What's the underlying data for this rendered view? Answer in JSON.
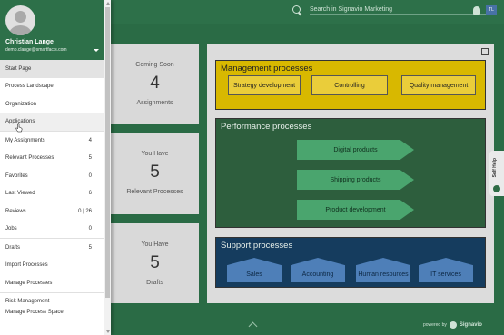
{
  "search": {
    "placeholder": "Search in Signavio Marketing"
  },
  "topbar": {
    "avatar_initials": "TL"
  },
  "user": {
    "name": "Christian Lange",
    "email": "demo.clange@smartfacts.com"
  },
  "sidebar": {
    "items": [
      {
        "label": "Start Page",
        "count": "",
        "state": "active"
      },
      {
        "label": "Process Landscape",
        "count": ""
      },
      {
        "label": "Organization",
        "count": ""
      },
      {
        "label": "Applications",
        "count": "",
        "state": "hover"
      },
      {
        "label": "My Assignments",
        "count": "4"
      },
      {
        "label": "Relevant Processes",
        "count": "5"
      },
      {
        "label": "Favorites",
        "count": "0"
      },
      {
        "label": "Last Viewed",
        "count": "6"
      },
      {
        "label": "Reviews",
        "count": "0 | 26"
      },
      {
        "label": "Jobs",
        "count": "0"
      },
      {
        "label": "Drafts",
        "count": "5"
      },
      {
        "label": "Import Processes",
        "count": ""
      },
      {
        "label": "Manage Processes",
        "count": ""
      },
      {
        "label": "Risk Management",
        "count": ""
      },
      {
        "label": "Manage Process Space",
        "count": ""
      }
    ]
  },
  "cards": [
    {
      "line1": "Coming Soon",
      "number": "4",
      "line2": "Assignments"
    },
    {
      "line1": "You Have",
      "number": "5",
      "line2": "Relevant Processes"
    },
    {
      "line1": "You Have",
      "number": "5",
      "line2": "Drafts"
    }
  ],
  "process_map": {
    "management": {
      "title": "Management processes",
      "items": [
        "Strategy development",
        "Controlling",
        "Quality management"
      ]
    },
    "performance": {
      "title": "Performance processes",
      "items": [
        "Digital products",
        "Shipping products",
        "Product development"
      ]
    },
    "support": {
      "title": "Support processes",
      "items": [
        "Sales",
        "Accounting",
        "Human resources",
        "IT services"
      ]
    }
  },
  "footer": {
    "powered_by": "powered by",
    "brand": "Signavio"
  },
  "self_help": {
    "label": "Self Help"
  },
  "colors": {
    "header_green": "#2d7049",
    "management": "#d8b800",
    "performance": "#2d5e3d",
    "performance_arrow": "#4aa56e",
    "support": "#153c5e",
    "support_item": "#4e7fb8"
  }
}
